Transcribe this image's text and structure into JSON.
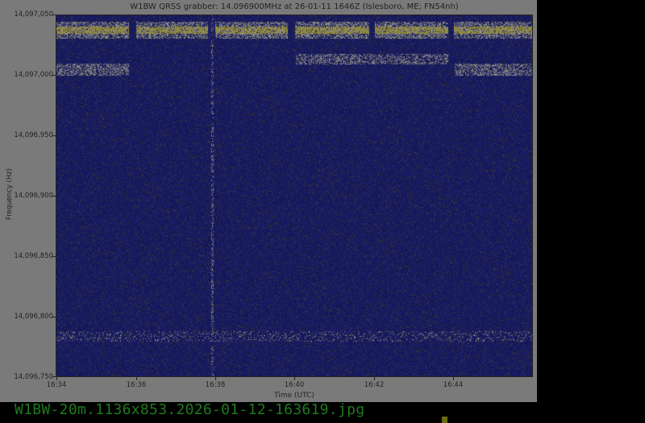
{
  "plot": {
    "title": "W1BW QRSS grabber: 14.096900MHz at 26-01-11 1646Z (Islesboro, ME; FN54nh)",
    "xlabel": "Time (UTC)",
    "ylabel": "Frequency (Hz)",
    "y_ticks": [
      "14,097,050",
      "14,097,000",
      "14,096,950",
      "14,096,900",
      "14,096,850",
      "14,096,800",
      "14,096,750"
    ],
    "x_ticks": [
      "16:34",
      "16:36",
      "16:38",
      "16:40",
      "16:42",
      "16:44"
    ],
    "colors": {
      "background": "#7a7a7a",
      "noise": "#14185e",
      "signal": "#b5a824",
      "trace": "#9a9a9a"
    }
  },
  "terminal": {
    "filename": "W1BW-20m.1136x853.2026-01-12-163619.jpg"
  }
}
